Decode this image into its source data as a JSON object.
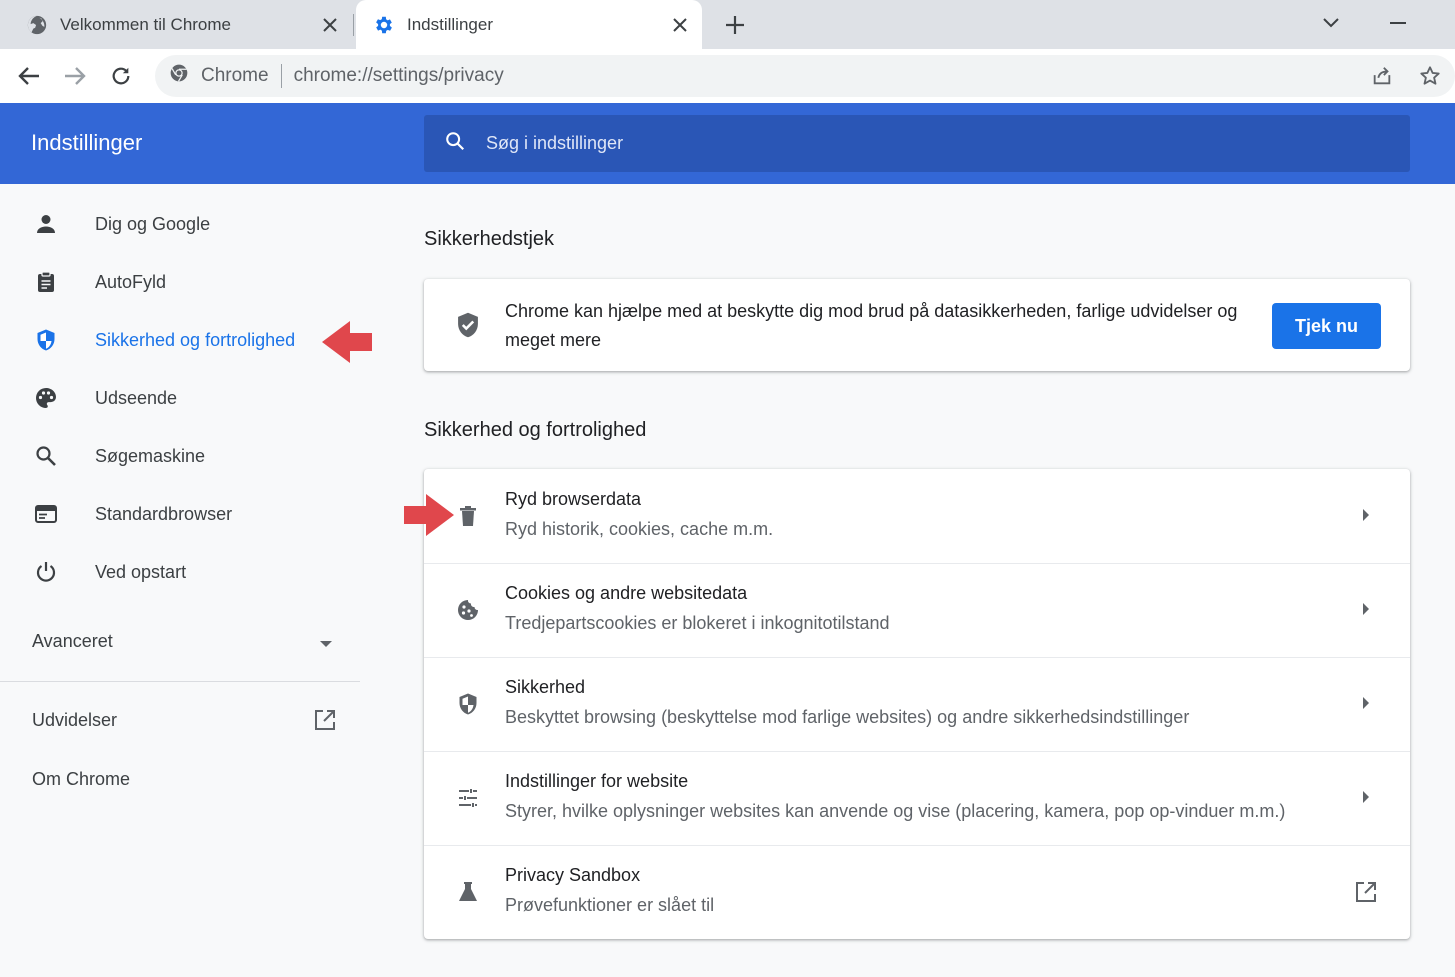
{
  "browser": {
    "tabs": [
      {
        "title": "Velkommen til Chrome",
        "active": false
      },
      {
        "title": "Indstillinger",
        "active": true
      }
    ],
    "omnibox": {
      "site_label": "Chrome",
      "url": "chrome://settings/privacy"
    }
  },
  "header": {
    "title": "Indstillinger",
    "search_placeholder": "Søg i indstillinger"
  },
  "sidebar": {
    "items": [
      {
        "label": "Dig og Google",
        "icon": "person-icon"
      },
      {
        "label": "AutoFyld",
        "icon": "clipboard-icon"
      },
      {
        "label": "Sikkerhed og fortrolighed",
        "icon": "shield-icon",
        "selected": true
      },
      {
        "label": "Udseende",
        "icon": "palette-icon"
      },
      {
        "label": "Søgemaskine",
        "icon": "search-icon"
      },
      {
        "label": "Standardbrowser",
        "icon": "browser-window-icon"
      },
      {
        "label": "Ved opstart",
        "icon": "power-icon"
      }
    ],
    "advanced_label": "Avanceret",
    "extensions_label": "Udvidelser",
    "about_label": "Om Chrome"
  },
  "main": {
    "safety_check": {
      "section_title": "Sikkerhedstjek",
      "text": "Chrome kan hjælpe med at beskytte dig mod brud på datasikkerheden, farlige udvidelser og meget mere",
      "button_label": "Tjek nu"
    },
    "privacy": {
      "section_title": "Sikkerhed og fortrolighed",
      "rows": [
        {
          "title": "Ryd browserdata",
          "subtitle": "Ryd historik, cookies, cache m.m.",
          "icon": "trash-icon"
        },
        {
          "title": "Cookies og andre websitedata",
          "subtitle": "Tredjepartscookies er blokeret i inkognitotilstand",
          "icon": "cookie-icon"
        },
        {
          "title": "Sikkerhed",
          "subtitle": "Beskyttet browsing (beskyttelse mod farlige websites) og andre sikkerhedsindstillinger",
          "icon": "shield-icon"
        },
        {
          "title": "Indstillinger for website",
          "subtitle": "Styrer, hvilke oplysninger websites kan anvende og vise (placering, kamera, pop op-vinduer m.m.)",
          "icon": "sliders-icon"
        },
        {
          "title": "Privacy Sandbox",
          "subtitle": "Prøvefunktioner er slået til",
          "icon": "flask-icon"
        }
      ]
    }
  },
  "colors": {
    "header_blue": "#3367d6",
    "accent": "#1a73e8",
    "annotation_red": "#e0474c"
  }
}
